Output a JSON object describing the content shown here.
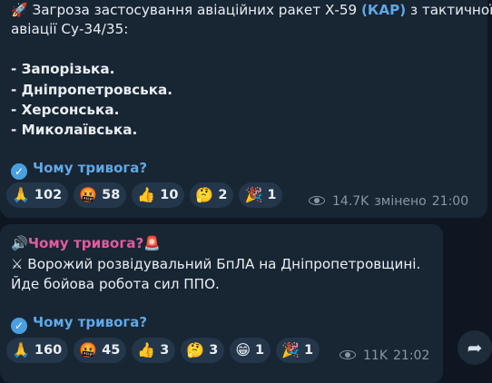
{
  "message1": {
    "line1_icon": "🚀",
    "line1_text": "Загроза застосування авіаційних ракет Х-59 ",
    "line1_accent": "(КАР)",
    "line1_tail": " з тактичної",
    "line2": "авіації Су-34/35:",
    "regions": [
      "- Запорізька.",
      "- Дніпропетровська.",
      "- Херсонська.",
      "- Миколаївська."
    ],
    "link_text": "Чому тривога?",
    "reactions": [
      {
        "icon": "🙏",
        "count": "102"
      },
      {
        "icon": "🤬",
        "count": "58"
      },
      {
        "icon": "👍",
        "count": "10"
      },
      {
        "icon": "🤔",
        "count": "2"
      },
      {
        "icon": "🎉",
        "count": "1"
      }
    ],
    "views": "14.7K",
    "edited_label": "змінено",
    "time": "21:00"
  },
  "message2": {
    "header_icon": "🔊",
    "header_text": "Чому тривога?",
    "header_emoji": "🚨",
    "line1_icon": "⚔",
    "line1": "Ворожий розвідувальний БпЛА на Дніпропетровщині.",
    "line2": "Йде бойова робота сил ППО.",
    "link_text": "Чому тривога?",
    "reactions": [
      {
        "icon": "🙏",
        "count": "160"
      },
      {
        "icon": "🤬",
        "count": "45"
      },
      {
        "icon": "👍",
        "count": "3"
      },
      {
        "icon": "🤔",
        "count": "3"
      },
      {
        "icon": "😁",
        "count": "1"
      },
      {
        "icon": "🎉",
        "count": "1"
      }
    ],
    "views": "11K",
    "time": "21:02"
  },
  "colors": {
    "background": "#0e1621",
    "bubble": "#182533",
    "accent": "#5fa8e5",
    "pink": "#e05ba1"
  },
  "icons": {
    "share": "share-arrow-icon",
    "views": "eye-icon",
    "verified": "verified-badge-icon"
  }
}
